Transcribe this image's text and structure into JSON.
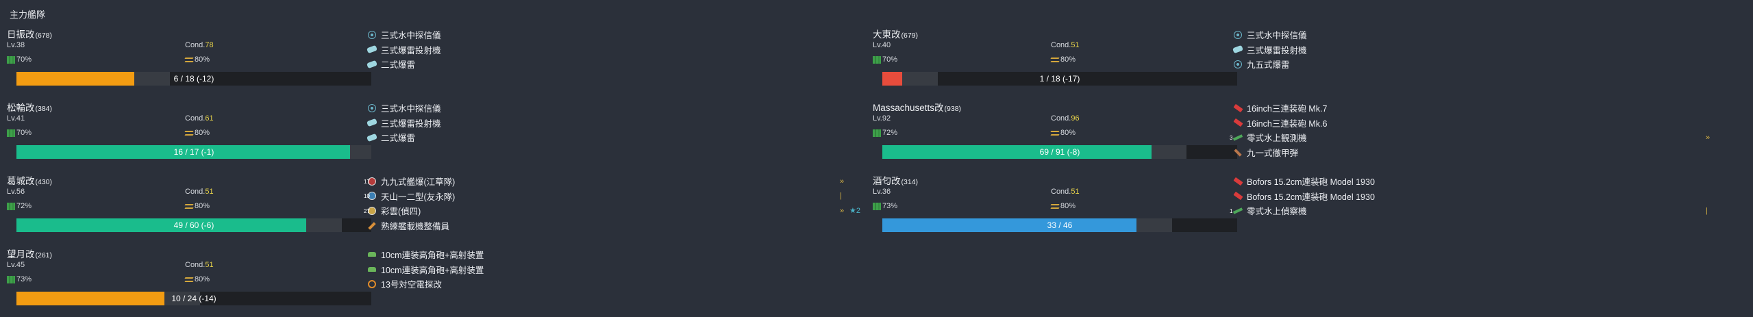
{
  "fleet_title": "主力艦隊",
  "labels": {
    "lv_prefix": "Lv.",
    "cond_prefix": "Cond."
  },
  "ships": [
    {
      "name": "日振改",
      "id": "(678)",
      "lv": "38",
      "cond": "78",
      "fuel": "70%",
      "ammo": "80%",
      "hp_text": "6 / 18 (-12)",
      "hp_fraction": 0.333,
      "hp_color": "#f39c12",
      "equip": [
        {
          "icon": "sonar-icon",
          "name": "三式水中探信儀"
        },
        {
          "icon": "depth-charge-projector-icon",
          "name": "三式爆雷投射機"
        },
        {
          "icon": "depth-charge-icon",
          "name": "二式爆雷"
        }
      ]
    },
    {
      "name": "大東改",
      "id": "(679)",
      "lv": "40",
      "cond": "51",
      "fuel": "70%",
      "ammo": "80%",
      "hp_text": "1 / 18 (-17)",
      "hp_fraction": 0.056,
      "hp_color": "#e74c3c",
      "equip": [
        {
          "icon": "sonar-icon",
          "name": "三式水中探信儀"
        },
        {
          "icon": "depth-charge-projector-icon",
          "name": "三式爆雷投射機"
        },
        {
          "icon": "sonar-icon",
          "name": "九五式爆雷"
        }
      ]
    },
    {
      "name": "松輪改",
      "id": "(384)",
      "lv": "41",
      "cond": "61",
      "fuel": "70%",
      "ammo": "80%",
      "hp_text": "16 / 17 (-1)",
      "hp_fraction": 0.941,
      "hp_color": "#1abc8c",
      "equip": [
        {
          "icon": "sonar-icon",
          "name": "三式水中探信儀"
        },
        {
          "icon": "depth-charge-projector-icon",
          "name": "三式爆雷投射機"
        },
        {
          "icon": "depth-charge-icon",
          "name": "二式爆雷"
        }
      ]
    },
    {
      "name": "Massachusetts改",
      "id": "(938)",
      "lv": "92",
      "cond": "96",
      "fuel": "72%",
      "ammo": "80%",
      "hp_text": "69 / 91 (-8)",
      "hp_fraction": 0.758,
      "hp_color": "#1abc8c",
      "equip": [
        {
          "icon": "large-gun-icon",
          "name": "16inch三連装砲 Mk.7"
        },
        {
          "icon": "large-gun-icon",
          "name": "16inch三連装砲 Mk.6"
        },
        {
          "icon": "seaplane-icon",
          "name": "零式水上観測機",
          "slots": "3",
          "prof": "»"
        },
        {
          "icon": "ap-shell-icon",
          "name": "九一式徹甲弾"
        }
      ]
    },
    {
      "name": "葛城改",
      "id": "(430)",
      "lv": "56",
      "cond": "51",
      "fuel": "72%",
      "ammo": "80%",
      "hp_text": "49 / 60 (-6)",
      "hp_fraction": 0.817,
      "hp_color": "#1abc8c",
      "equip": [
        {
          "icon": "dive-bomber-icon",
          "name": "九九式艦爆(江草隊)",
          "slots": "17",
          "prof": "»"
        },
        {
          "icon": "torpedo-bomber-icon",
          "name": "天山一二型(友永隊)",
          "slots": "10",
          "prof": "|"
        },
        {
          "icon": "recon-plane-icon",
          "name": "彩雲(偵四)",
          "slots": "27",
          "prof": "»",
          "plus": "★2"
        },
        {
          "icon": "wrench-icon",
          "name": "熟練艦載機整備員"
        }
      ]
    },
    {
      "name": "酒匂改",
      "id": "(314)",
      "lv": "36",
      "cond": "51",
      "fuel": "73%",
      "ammo": "80%",
      "hp_text": "33 / 46",
      "hp_fraction": 0.717,
      "hp_color": "#3498db",
      "equip": [
        {
          "icon": "large-gun-icon",
          "name": "Bofors 15.2cm連装砲 Model 1930"
        },
        {
          "icon": "large-gun-icon",
          "name": "Bofors 15.2cm連装砲 Model 1930"
        },
        {
          "icon": "seaplane-icon",
          "name": "零式水上偵察機",
          "slots": "1",
          "prof": "|"
        }
      ]
    },
    {
      "name": "望月改",
      "id": "(261)",
      "lv": "45",
      "cond": "51",
      "fuel": "73%",
      "ammo": "80%",
      "hp_text": "10 / 24 (-14)",
      "hp_fraction": 0.417,
      "hp_color": "#f39c12",
      "equip": [
        {
          "icon": "aa-gun-icon",
          "name": "10cm連装高角砲+高射装置"
        },
        {
          "icon": "aa-gun-icon",
          "name": "10cm連装高角砲+高射装置"
        },
        {
          "icon": "radar-icon",
          "name": "13号対空電探改"
        }
      ]
    }
  ]
}
